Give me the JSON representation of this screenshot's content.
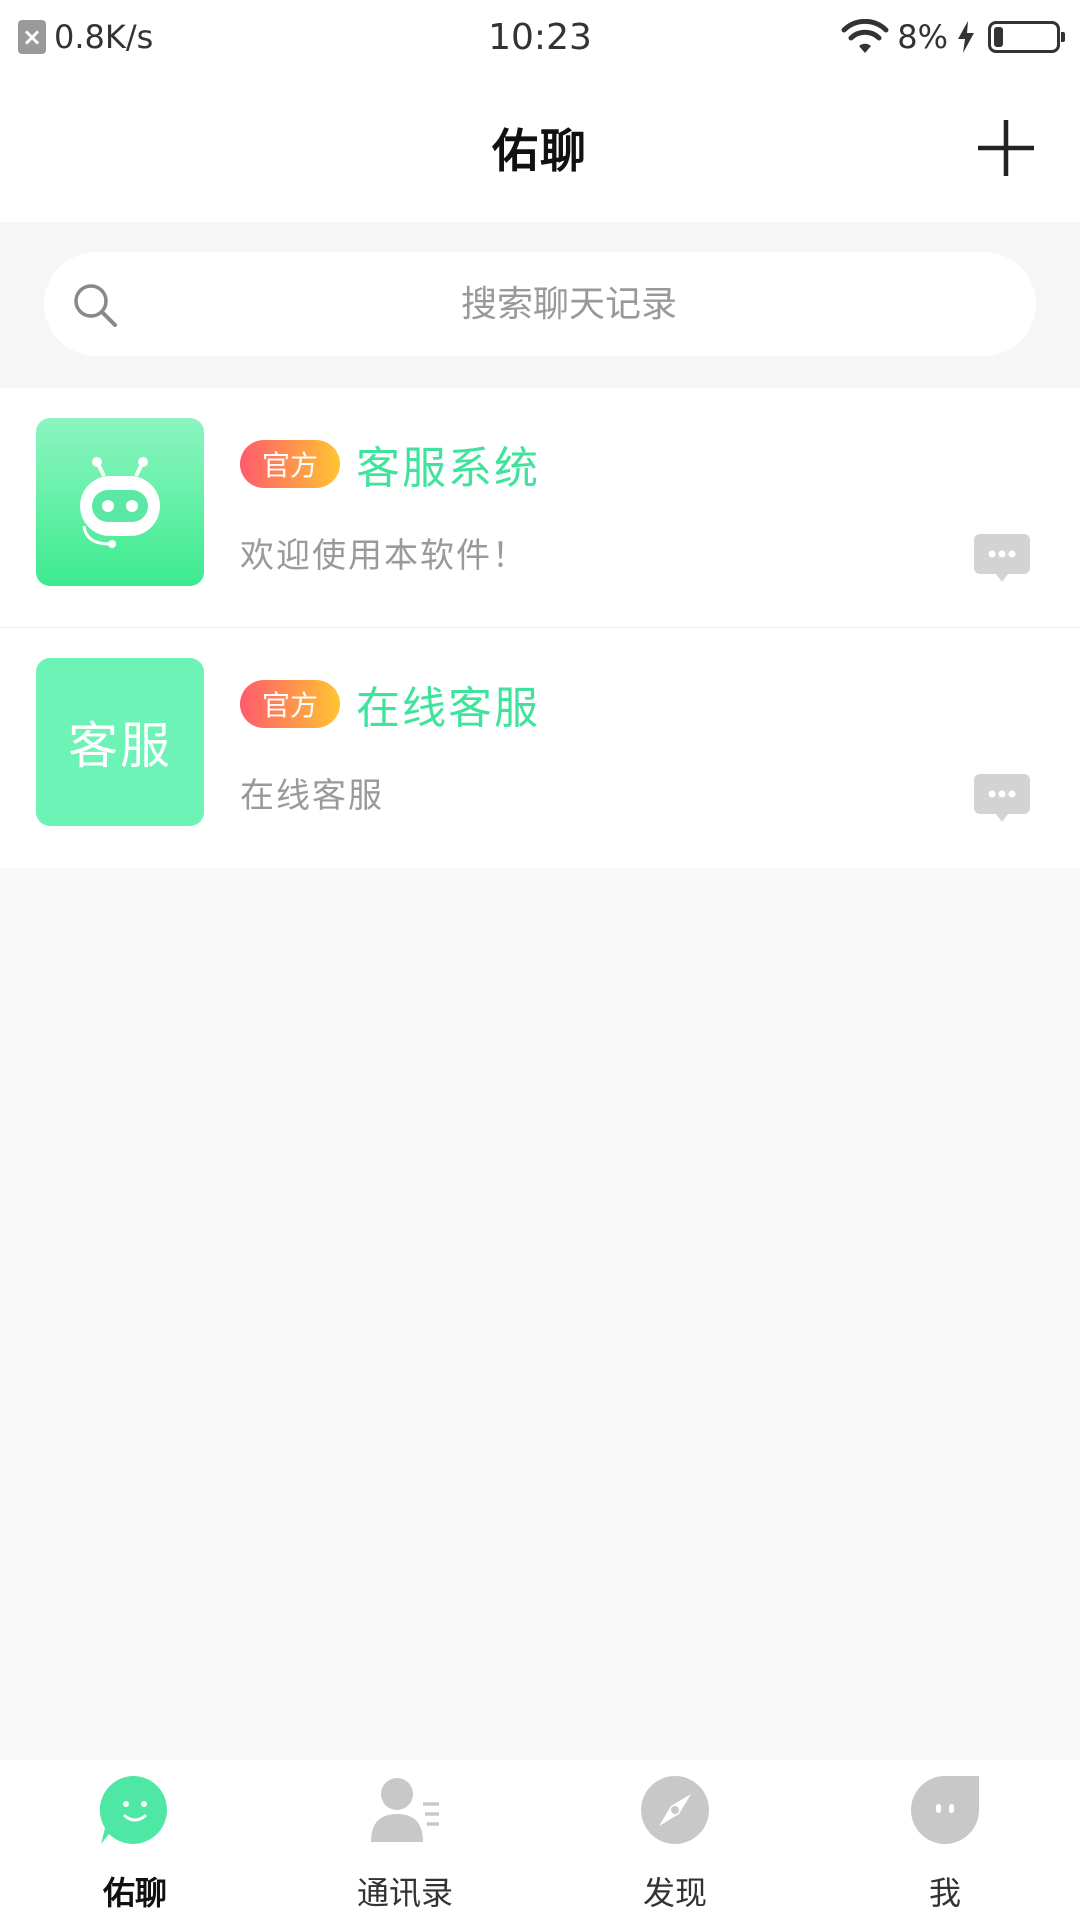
{
  "status_bar": {
    "net_speed": "0.8K/s",
    "time": "10:23",
    "battery_percent": "8%",
    "battery_level_fraction": 0.08
  },
  "header": {
    "title": "佑聊",
    "add_icon": "plus-icon"
  },
  "search": {
    "placeholder": "搜索聊天记录",
    "icon": "search-icon"
  },
  "chats": [
    {
      "badge": "官方",
      "name": "客服系统",
      "preview": "欢迎使用本软件！",
      "avatar_type": "robot-icon"
    },
    {
      "badge": "官方",
      "name": "在线客服",
      "preview": "在线客服",
      "avatar_text": "客服"
    }
  ],
  "bottom_nav": [
    {
      "label": "佑聊",
      "icon": "chat-bubble-icon",
      "active": true,
      "color": "#4fe7a4"
    },
    {
      "label": "通讯录",
      "icon": "contacts-icon",
      "active": false,
      "color": "#c8c8c8"
    },
    {
      "label": "发现",
      "icon": "compass-icon",
      "active": false,
      "color": "#c8c8c8"
    },
    {
      "label": "我",
      "icon": "profile-bubble-icon",
      "active": false,
      "color": "#c8c8c8"
    }
  ],
  "colors": {
    "accent": "#3fe39c",
    "badge_start": "#ff5a6c",
    "badge_end": "#ffc531",
    "inactive_icon": "#c8c8c8"
  }
}
